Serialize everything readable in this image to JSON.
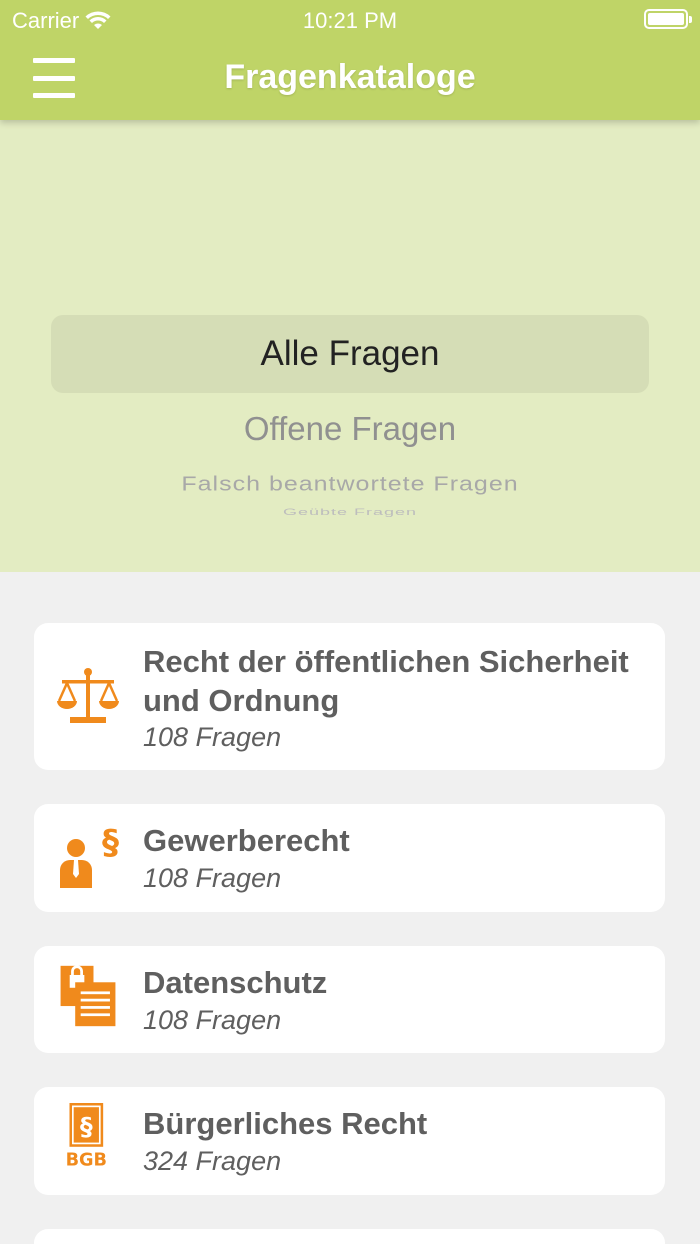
{
  "status_bar": {
    "carrier": "Carrier",
    "time": "10:21 PM"
  },
  "header": {
    "title": "Fragenkataloge",
    "background": "#bfd467"
  },
  "picker": {
    "options": [
      "Alle Fragen",
      "Offene Fragen",
      "Falsch beantwortete Fragen",
      "Geübte Fragen"
    ],
    "selected": "Alle Fragen"
  },
  "catalogs": [
    {
      "title": "Recht der öffentlichen Sicherheit und Ordnung",
      "count": "108 Fragen",
      "icon": "scales-icon"
    },
    {
      "title": "Gewerberecht",
      "count": "108 Fragen",
      "icon": "person-paragraph-icon"
    },
    {
      "title": "Datenschutz",
      "count": "108 Fragen",
      "icon": "lock-document-icon"
    },
    {
      "title": "Bürgerliches Recht",
      "count": "324 Fragen",
      "icon": "bgb-book-icon",
      "icon_text": "BGB"
    }
  ],
  "colors": {
    "accent": "#f08a1c",
    "picker_bg": "#e3ecc2",
    "list_bg": "#f0f0f0"
  }
}
